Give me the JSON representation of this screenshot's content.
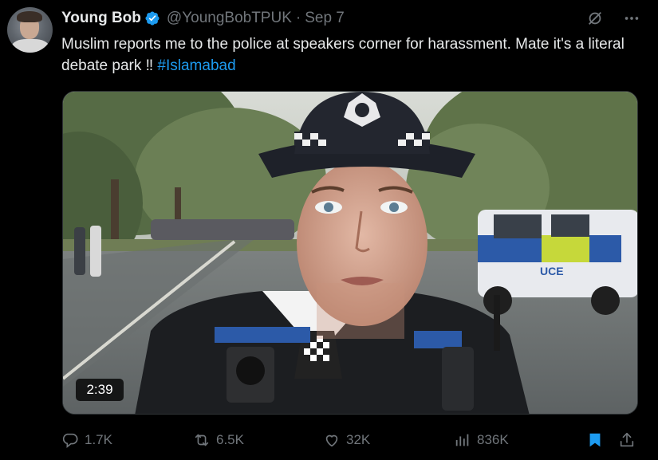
{
  "author": {
    "display_name": "Young Bob",
    "handle": "@YoungBobTPUK",
    "separator": "·",
    "date": "Sep 7",
    "verified": true
  },
  "tweet": {
    "text_before_hashtag": "Muslim reports me to the police at speakers corner for harassment. Mate it's a literal debate park ‼ ",
    "hashtag": "#Islamabad"
  },
  "media": {
    "duration": "2:39",
    "van_text": "UCE"
  },
  "actions": {
    "replies": "1.7K",
    "reposts": "6.5K",
    "likes": "32K",
    "views": "836K",
    "bookmarked": true
  },
  "icons": {
    "reply": "reply-icon",
    "repost": "repost-icon",
    "like": "heart-icon",
    "views": "views-icon",
    "bookmark": "bookmark-icon",
    "share": "share-icon",
    "grok": "grok-icon",
    "more": "more-icon",
    "verified": "verified-badge-icon"
  },
  "colors": {
    "background": "#000000",
    "text_primary": "#e7e9ea",
    "text_secondary": "#71767b",
    "accent_blue": "#1d9bf0"
  }
}
